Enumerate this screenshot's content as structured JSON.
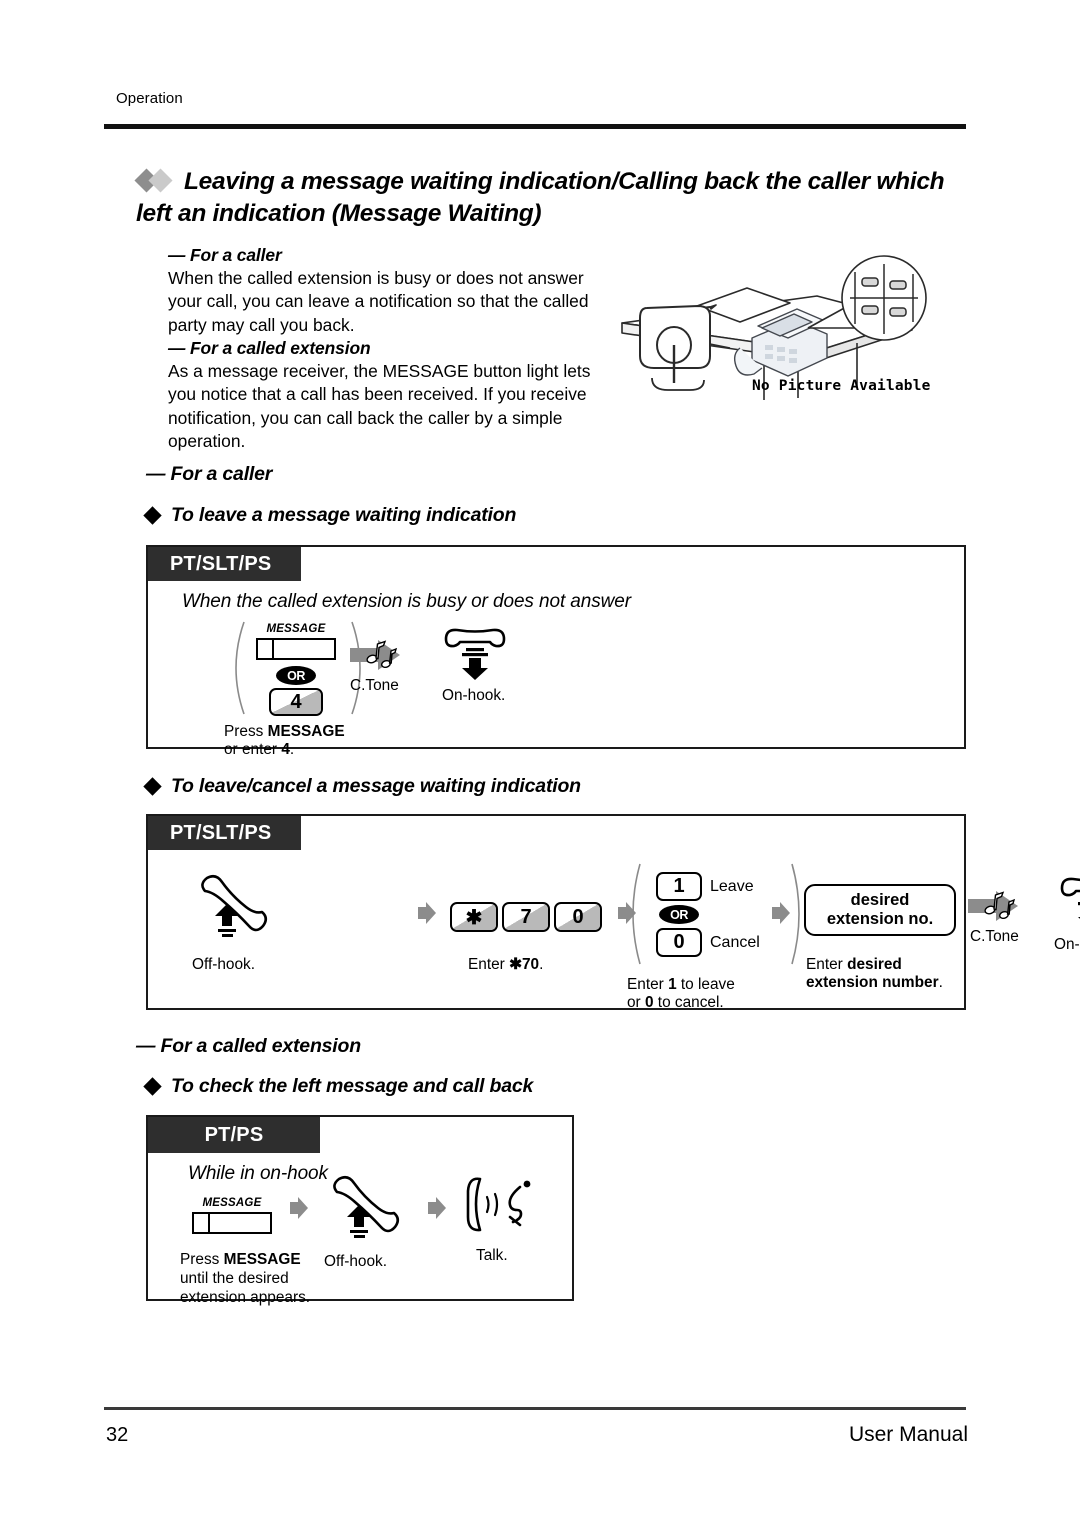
{
  "header": {
    "running_head": "Operation",
    "title": "Leaving a message waiting indication/Calling back the caller which left an indication (Message Waiting)"
  },
  "intro": {
    "caller_heading": "— For a caller",
    "caller_body": "When the called extension is busy or does not answer your call, you can leave a notification so that the called party may call you back.",
    "called_heading": "— For a called extension",
    "called_body": "As a message receiver, the MESSAGE button light lets you notice that a call has been received. If you receive notification, you can call back the caller by a simple operation."
  },
  "illustration": {
    "placeholder_text": "No Picture Available"
  },
  "sections": [
    {
      "dash_heading": "— For a caller",
      "diamond_heading": "To leave a message waiting indication",
      "box": {
        "tag": "PT/SLT/PS",
        "condition": "When the called extension is busy or does not answer",
        "steps": [
          {
            "key_label": "MESSAGE",
            "or_label": "OR",
            "alt_key": "4",
            "caption_line1_prefix": "Press ",
            "caption_line1_bold": "MESSAGE",
            "caption_line2_prefix": "or enter ",
            "caption_line2_bold": "4",
            "caption_line2_suffix": "."
          },
          {
            "icon": "c-tone-icon",
            "caption": "C.Tone"
          },
          {
            "icon": "on-hook-icon",
            "caption": "On-hook."
          }
        ]
      }
    },
    {
      "diamond_heading": "To leave/cancel a message waiting indication",
      "box": {
        "tag": "PT/SLT/PS",
        "steps": [
          {
            "icon": "off-hook-icon",
            "caption": "Off-hook."
          },
          {
            "keys": [
              "✱",
              "7",
              "0"
            ],
            "caption_prefix": "Enter ",
            "caption_bold": "✱70",
            "caption_suffix": "."
          },
          {
            "option_keys": [
              {
                "key": "1",
                "label": "Leave"
              },
              {
                "key": "0",
                "label": "Cancel"
              }
            ],
            "or_label": "OR",
            "caption_line1_a": "Enter ",
            "caption_line1_b": "1",
            "caption_line1_c": " to leave",
            "caption_line2_a": "or ",
            "caption_line2_b": "0",
            "caption_line2_c": " to cancel."
          },
          {
            "rbox_line1": "desired",
            "rbox_line2": "extension no.",
            "caption_line1_a": "Enter ",
            "caption_line1_b": "desired",
            "caption_line2_b": "extension number",
            "caption_line2_c": "."
          },
          {
            "icon": "c-tone-icon",
            "caption": "C.Tone"
          },
          {
            "icon": "on-hook-icon",
            "caption": "On-hook."
          }
        ]
      }
    },
    {
      "dash_heading": "— For a called extension",
      "diamond_heading": "To check the left message and call back",
      "box": {
        "tag": "PT/PS",
        "condition": "While in on-hook",
        "steps": [
          {
            "key_label": "MESSAGE",
            "caption_line1_prefix": "Press ",
            "caption_line1_bold": "MESSAGE",
            "caption_line2": "until the desired",
            "caption_line3": "extension appears."
          },
          {
            "icon": "off-hook-icon",
            "caption": "Off-hook."
          },
          {
            "icon": "talk-icon",
            "caption": "Talk."
          }
        ]
      }
    }
  ],
  "footer": {
    "page_number": "32",
    "doc_label": "User Manual"
  },
  "colors": {
    "tag_background": "#2e2e2e",
    "rule": "#111111",
    "key_shade": "#b9b9b9",
    "arrow_gray": "#8c8c8c",
    "diamond_dark": "#8e8e8e",
    "diamond_light": "#cacaca"
  }
}
